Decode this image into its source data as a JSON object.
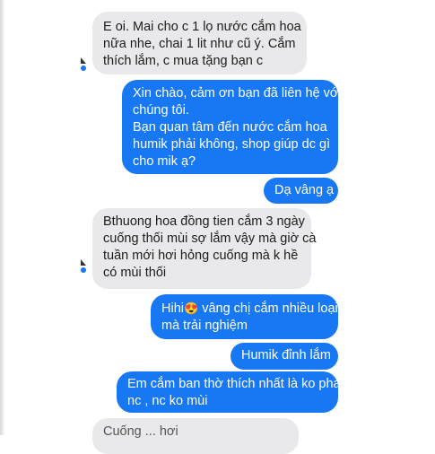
{
  "messages": [
    {
      "side": "received",
      "lines": [
        "E oi. Mai cho c 1 lọ nước cắm hoa",
        "nữa nhe, chai 1 lit như cũ ý. Cắm",
        "thích lắm, c mua tặng bạn c"
      ]
    },
    {
      "side": "sent",
      "lines": [
        "Xin chào, cảm ơn bạn đã liên hệ với",
        "chúng tôi.",
        "Bạn quan tâm đến nước cắm hoa",
        "humik phải không, shop giúp dc gì",
        "cho mik ạ?"
      ]
    },
    {
      "side": "sent",
      "lines": [
        "Dạ vâng ạ"
      ]
    },
    {
      "side": "received",
      "lines": [
        "Bthuong hoa đồng tien cắm 3 ngày",
        "cuống thối mùi sợ lắm vậy mà giờ cà",
        "tuần mới hơi hỏng cuống mà k hề",
        "có mùi thối"
      ]
    },
    {
      "side": "sent",
      "lines": [
        "Hihi",
        "vâng chị cắm nhiều loại hoa",
        "mà trải nghiệm"
      ],
      "emoji": "😍"
    },
    {
      "side": "sent",
      "lines": [
        "Humik đỉnh lắm"
      ]
    },
    {
      "side": "sent",
      "lines": [
        "Em cắm ban thờ thích nhất là ko phải",
        "nc , nc ko mùi"
      ]
    }
  ],
  "cut_off_text": "Cuống ... hơi",
  "colors": {
    "received_bg": "#e9e9eb",
    "sent_bg": "#1877f2",
    "sent_text": "#ffffff"
  }
}
